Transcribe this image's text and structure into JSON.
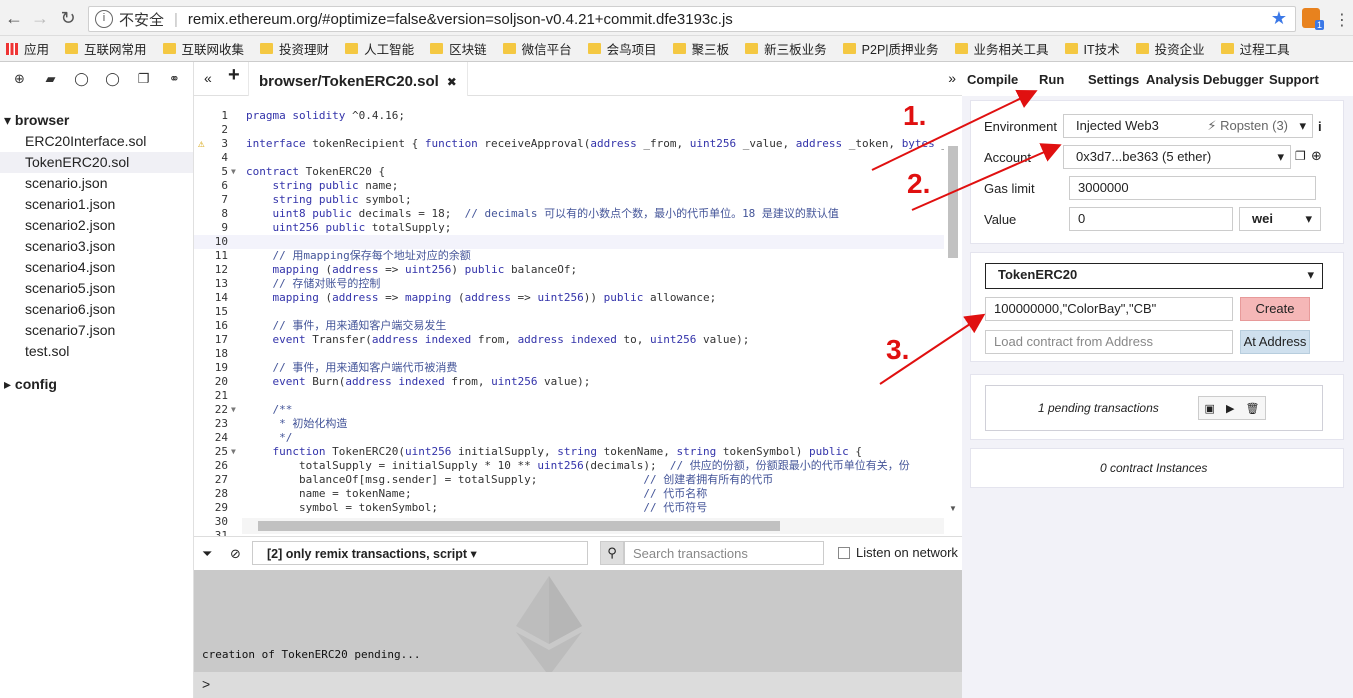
{
  "browser": {
    "security_label": "不安全",
    "url": "remix.ethereum.org/#optimize=false&version=soljson-v0.4.21+commit.dfe3193c.js",
    "extension_badge": "1",
    "bookmarks": [
      "应用",
      "互联网常用",
      "互联网收集",
      "投资理财",
      "人工智能",
      "区块链",
      "微信平台",
      "会鸟项目",
      "聚三板",
      "新三板业务",
      "P2P|质押业务",
      "业务相关工具",
      "IT技术",
      "投资企业",
      "过程工具"
    ]
  },
  "file_explorer": {
    "root_label": "browser",
    "files": [
      "ERC20Interface.sol",
      "TokenERC20.sol",
      "scenario.json",
      "scenario1.json",
      "scenario2.json",
      "scenario3.json",
      "scenario4.json",
      "scenario5.json",
      "scenario6.json",
      "scenario7.json",
      "test.sol"
    ],
    "config_label": "config"
  },
  "editor": {
    "tab_title": "browser/TokenERC20.sol",
    "line_numbers": [
      "1",
      "2",
      "3",
      "4",
      "5",
      "6",
      "7",
      "8",
      "9",
      "10",
      "11",
      "12",
      "13",
      "14",
      "15",
      "16",
      "17",
      "18",
      "19",
      "20",
      "21",
      "22",
      "23",
      "24",
      "25",
      "26",
      "27",
      "28",
      "29",
      "30",
      "31"
    ],
    "lines": [
      "pragma solidity ^0.4.16;",
      "",
      "interface tokenRecipient { function receiveApproval(address _from, uint256 _value, address _token, bytes _",
      "",
      "contract TokenERC20 {",
      "    string public name;",
      "    string public symbol;",
      "    uint8 public decimals = 18;  // decimals 可以有的小数点个数，最小的代币单位。18 是建议的默认值",
      "    uint256 public totalSupply;",
      "",
      "    // 用mapping保存每个地址对应的余额",
      "    mapping (address => uint256) public balanceOf;",
      "    // 存储对账号的控制",
      "    mapping (address => mapping (address => uint256)) public allowance;",
      "",
      "    // 事件，用来通知客户端交易发生",
      "    event Transfer(address indexed from, address indexed to, uint256 value);",
      "",
      "    // 事件，用来通知客户端代币被消费",
      "    event Burn(address indexed from, uint256 value);",
      "",
      "    /**",
      "     * 初始化构造",
      "     */",
      "    function TokenERC20(uint256 initialSupply, string tokenName, string tokenSymbol) public {",
      "        totalSupply = initialSupply * 10 ** uint256(decimals);  // 供应的份额，份额跟最小的代币单位有关，份",
      "        balanceOf[msg.sender] = totalSupply;                // 创建者拥有所有的代币",
      "        name = tokenName;                                   // 代币名称",
      "        symbol = tokenSymbol;                               // 代币符号",
      "",
      ""
    ]
  },
  "terminal": {
    "filter_label": "[2] only remix transactions, script",
    "search_placeholder": "Search transactions",
    "listen_label": "Listen on network",
    "log_message": "creation of TokenERC20 pending...",
    "prompt": ">"
  },
  "right_tabs": [
    "Compile",
    "Run",
    "Settings",
    "Analysis",
    "Debugger",
    "Support"
  ],
  "run": {
    "environment_label": "Environment",
    "environment_value": "Injected Web3",
    "network": "Ropsten (3)",
    "account_label": "Account",
    "account_value": "0x3d7...be363 (5 ether)",
    "gas_label": "Gas limit",
    "gas_value": "3000000",
    "value_label": "Value",
    "value_value": "0",
    "value_unit": "wei",
    "contract_select": "TokenERC20",
    "constructor_args": "100000000,\"ColorBay\",\"CB\"",
    "create_label": "Create",
    "load_placeholder": "Load contract from Address",
    "at_address_label": "At Address",
    "pending_text": "1 pending transactions",
    "instances_text": "0 contract Instances"
  },
  "annotations": [
    "1.",
    "2.",
    "3."
  ],
  "colors": {
    "annotation": "#e01010",
    "create_button": "#f5b7b7",
    "at_address_button": "#cfe0ee"
  }
}
